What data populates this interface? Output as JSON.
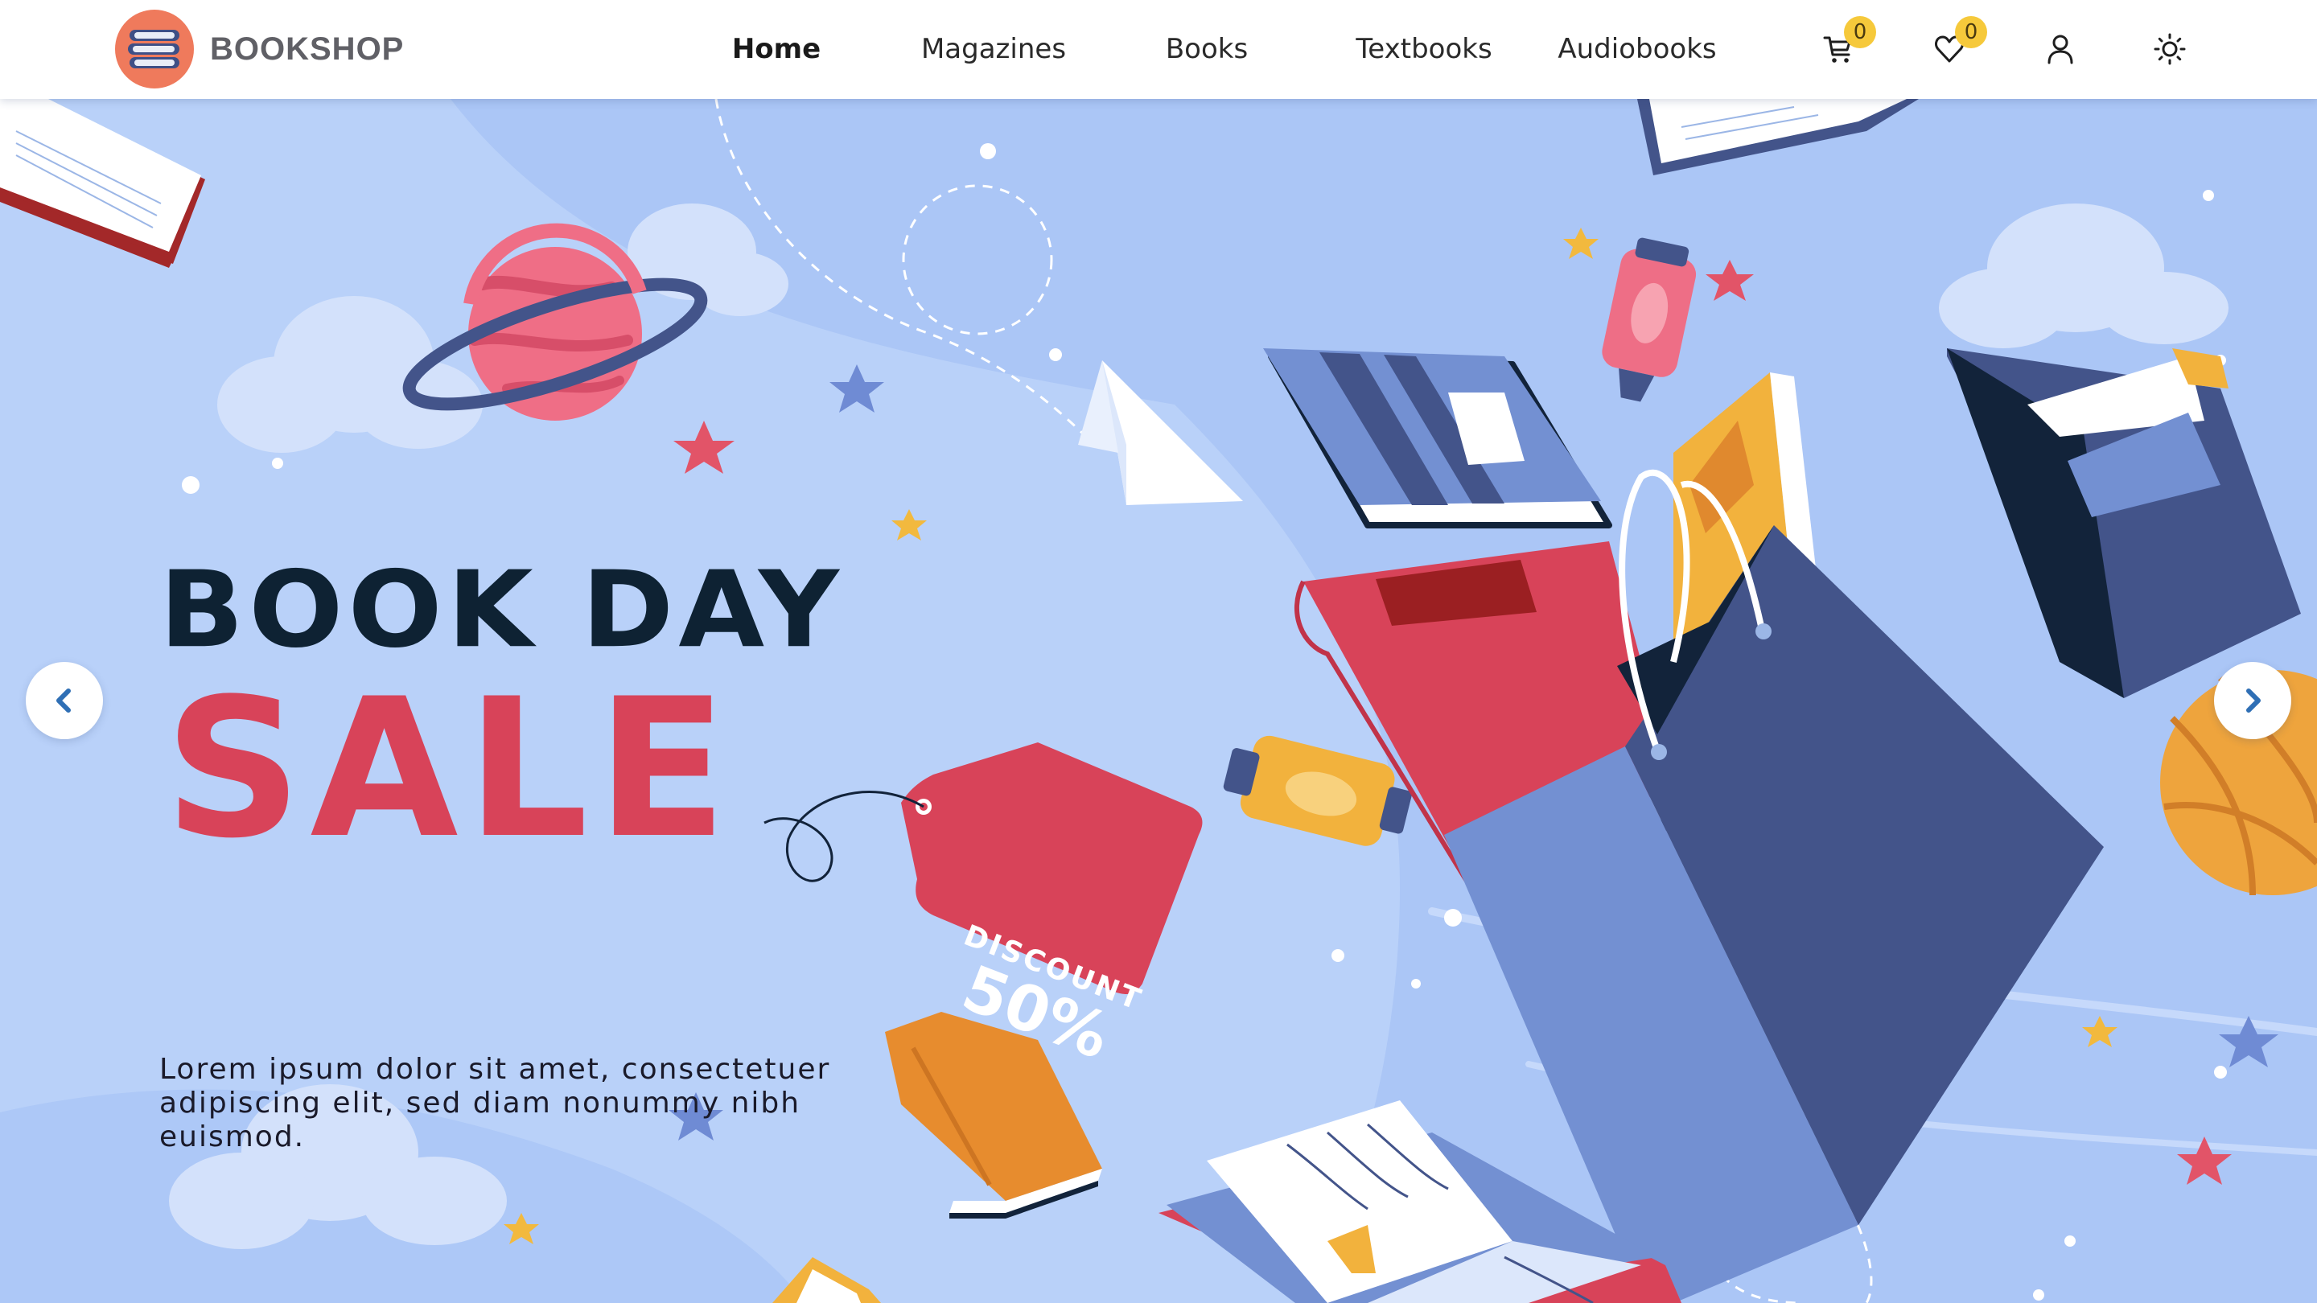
{
  "brand": {
    "name": "BOOKSHOP",
    "logo_icon": "books-stack-icon",
    "logo_color": "#ef7a5c"
  },
  "nav": {
    "items": [
      {
        "label": "Home",
        "active": true
      },
      {
        "label": "Magazines",
        "active": false
      },
      {
        "label": "Books",
        "active": false
      },
      {
        "label": "Textbooks",
        "active": false
      },
      {
        "label": "Audiobooks",
        "active": false
      }
    ],
    "cart": {
      "icon": "cart-icon",
      "count": "0"
    },
    "wishlist": {
      "icon": "heart-icon",
      "count": "0"
    },
    "account": {
      "icon": "user-icon"
    },
    "theme": {
      "icon": "sun-icon"
    }
  },
  "hero": {
    "headline_line1": "BOOK DAY",
    "headline_line2": "SALE",
    "tag_line1": "DISCOUNT",
    "tag_line2": "50%",
    "description": "Lorem ipsum dolor sit amet, consectetuer adipiscing elit, sed diam nonummy nibh euismod.",
    "prev_icon": "chevron-left-icon",
    "next_icon": "chevron-right-icon"
  },
  "colors": {
    "background": "#b7cff8",
    "headline_dark": "#0e2233",
    "accent_red": "#d84359",
    "badge_yellow": "#f6c93b",
    "bag_blue": "#43548a",
    "arrow_blue": "#2f6fb5"
  }
}
